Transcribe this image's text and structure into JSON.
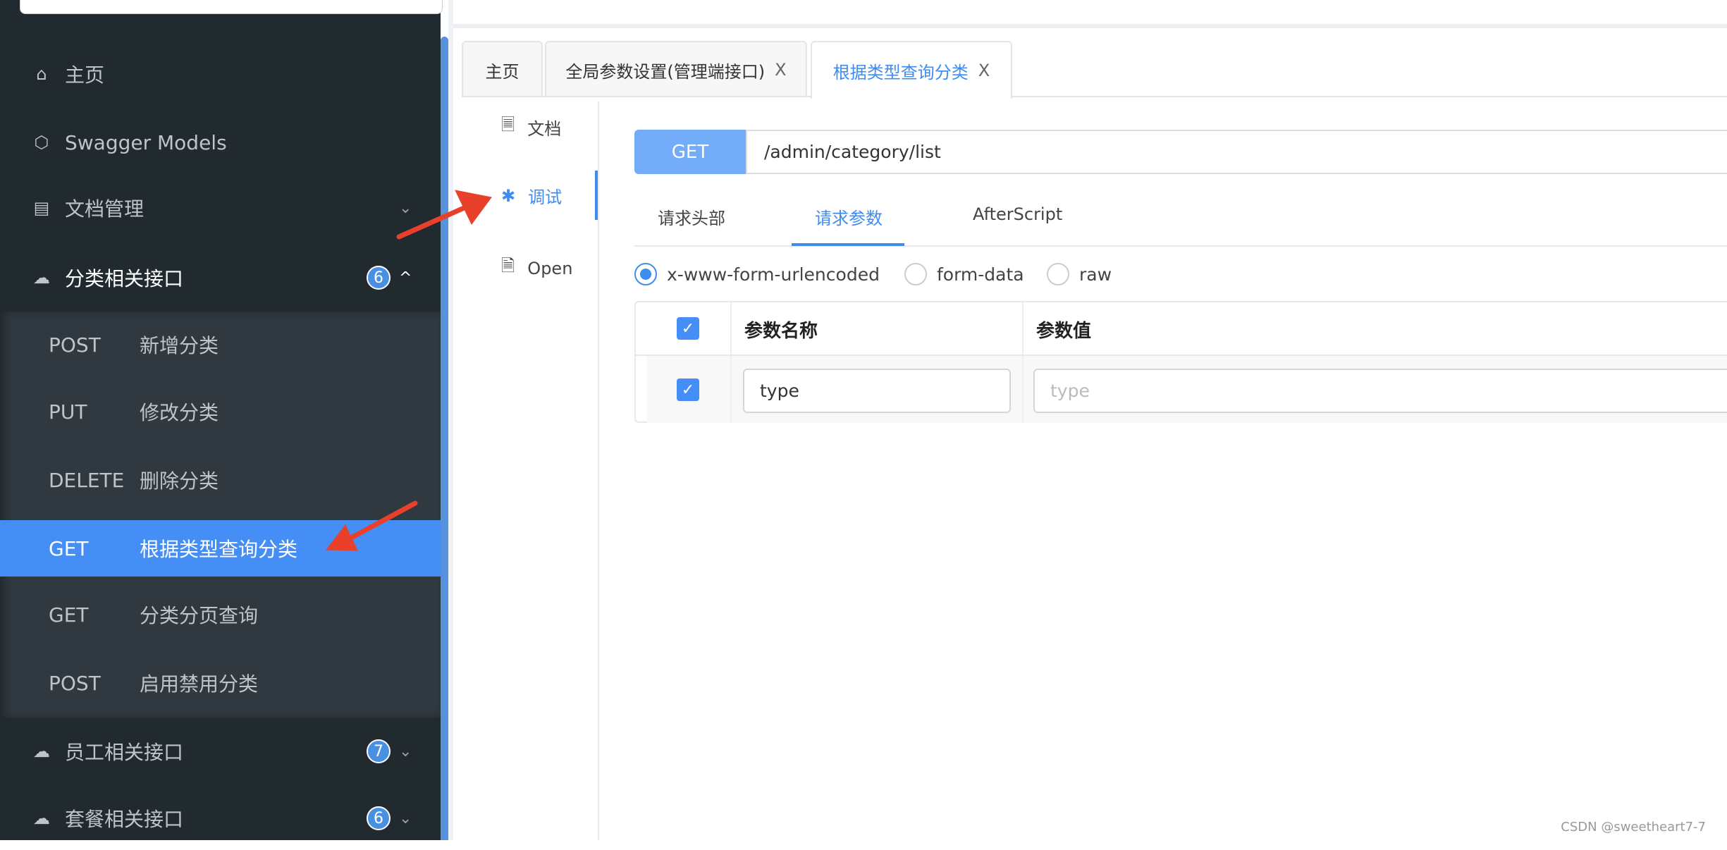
{
  "sidebar": {
    "search_placeholder": "",
    "items": [
      {
        "label": "主页",
        "icon": "home-icon"
      },
      {
        "label": "Swagger Models",
        "icon": "cube-icon"
      },
      {
        "label": "文档管理",
        "icon": "doc-settings-icon"
      },
      {
        "label": "分类相关接口",
        "icon": "cloud-api-icon",
        "count": "6",
        "expanded": true
      },
      {
        "label": "员工相关接口",
        "icon": "cloud-api-icon",
        "count": "7"
      },
      {
        "label": "套餐相关接口",
        "icon": "cloud-api-icon",
        "count": "6"
      }
    ],
    "sub_items": [
      {
        "method": "POST",
        "name": "新增分类"
      },
      {
        "method": "PUT",
        "name": "修改分类"
      },
      {
        "method": "DELETE",
        "name": "删除分类"
      },
      {
        "method": "GET",
        "name": "根据类型查询分类",
        "active": true
      },
      {
        "method": "GET",
        "name": "分类分页查询"
      },
      {
        "method": "POST",
        "name": "启用禁用分类"
      }
    ]
  },
  "tabs": [
    {
      "label": "主页"
    },
    {
      "label": "全局参数设置(管理端接口)",
      "close": "X"
    },
    {
      "label": "根据类型查询分类",
      "close": "X",
      "active": true
    }
  ],
  "left_nav": [
    {
      "label": "文档"
    },
    {
      "label": "调试",
      "active": true
    },
    {
      "label": "Open"
    }
  ],
  "request": {
    "method": "GET",
    "url": "/admin/category/list"
  },
  "sub_tabs": [
    {
      "label": "请求头部"
    },
    {
      "label": "请求参数",
      "active": true
    },
    {
      "label": "AfterScript"
    }
  ],
  "body_types": [
    {
      "label": "x-www-form-urlencoded",
      "selected": true
    },
    {
      "label": "form-data"
    },
    {
      "label": "raw"
    }
  ],
  "table": {
    "headers": [
      "参数名称",
      "参数值"
    ],
    "rows": [
      {
        "checked": true,
        "name": "type",
        "value_placeholder": "type"
      }
    ]
  },
  "watermark": "CSDN @sweetheart7-7",
  "colors": {
    "accent": "#448ef6",
    "sidebar_bg": "#212a2f",
    "annotation_arrow": "#e8402a"
  }
}
